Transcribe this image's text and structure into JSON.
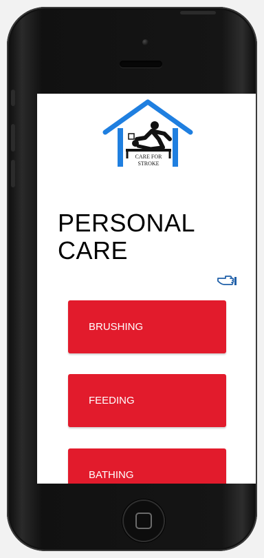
{
  "app": {
    "logo_text_line1": "CARE FOR",
    "logo_text_line2": "STROKE",
    "logo_color": "#1f7fe0"
  },
  "page": {
    "title_line1": "PERSONAL",
    "title_line2": "CARE"
  },
  "actions": [
    {
      "label": "BRUSHING"
    },
    {
      "label": "FEEDING"
    },
    {
      "label": "BATHING"
    }
  ],
  "colors": {
    "button_background": "#e21b2c",
    "button_text": "#ffffff",
    "icon_color": "#1f5fa8"
  },
  "icons": {
    "next": "pointing-hand-icon"
  }
}
